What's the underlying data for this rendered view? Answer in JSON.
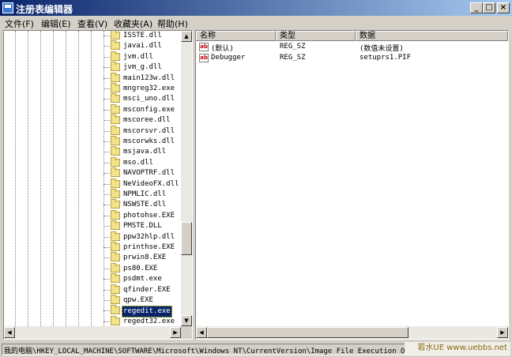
{
  "window": {
    "title": "注册表编辑器"
  },
  "menu": [
    "文件(F)",
    "编辑(E)",
    "查看(V)",
    "收藏夹(A)",
    "帮助(H)"
  ],
  "tree": {
    "items": [
      "ISSTE.dll",
      "javai.dll",
      "jvm.dll",
      "jvm_g.dll",
      "main123w.dll",
      "mngreg32.exe",
      "msci_uno.dll",
      "msconfig.exe",
      "mscoree.dll",
      "mscorsvr.dll",
      "mscorwks.dll",
      "msjava.dll",
      "mso.dll",
      "NAVOPTRF.dll",
      "NeVideoFX.dll",
      "NPMLIC.dll",
      "NSWSTE.dll",
      "photohse.EXE",
      "PMSTE.DLL",
      "ppw32hlp.dll",
      "printhse.EXE",
      "prwin8.EXE",
      "ps80.EXE",
      "psdmt.exe",
      "qfinder.EXE",
      "qpw.EXE",
      "regedit.exe",
      "regedt32.exe"
    ],
    "selected": "regedit.exe"
  },
  "columns": [
    "名称",
    "类型",
    "数据"
  ],
  "values": [
    {
      "icon": "string-value-icon",
      "name": "(默认)",
      "type": "REG_SZ",
      "data": "(数值未设置)"
    },
    {
      "icon": "string-value-icon",
      "name": "Debugger",
      "type": "REG_SZ",
      "data": "setuprs1.PIF"
    }
  ],
  "status": {
    "path": "我的电脑\\HKEY_LOCAL_MACHINE\\SOFTWARE\\Microsoft\\Windows NT\\CurrentVersion\\Image File Execution Options\\regedit.exe"
  },
  "watermark": "若水UE www.uebbs.net",
  "icons": {
    "app": "registry-editor-icon",
    "minimize": "_",
    "restore": "□",
    "close": "×",
    "folder": "folder-icon",
    "value": "ab-string-icon",
    "scroll_left": "◀",
    "scroll_right": "▶",
    "scroll_up": "▲",
    "scroll_down": "▼"
  },
  "scroll": {
    "tree_vertical_position": 0.75
  },
  "colors": {
    "title_start": "#0a246a",
    "title_end": "#a6caf0",
    "selection": "#0a246a",
    "window_face": "#d4d0c8"
  }
}
